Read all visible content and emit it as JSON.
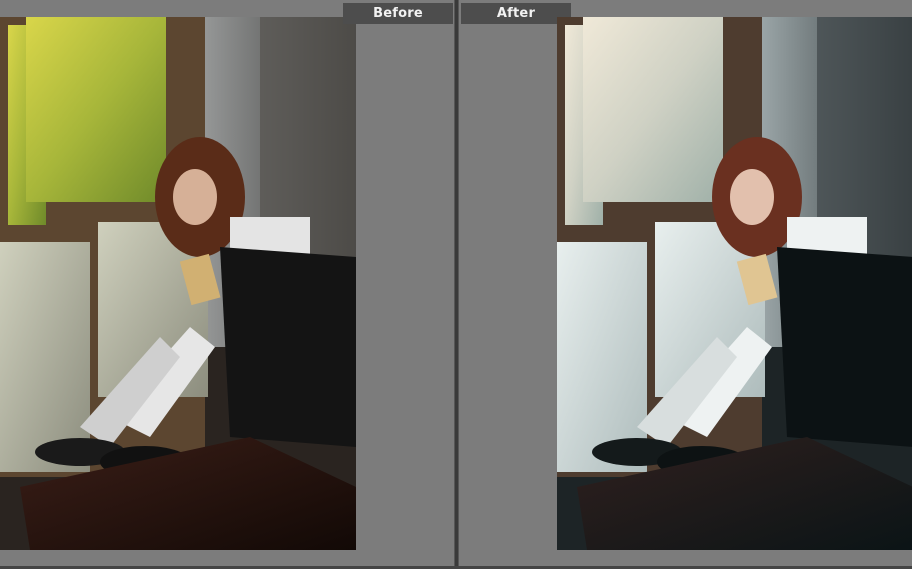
{
  "labels": {
    "before": "Before",
    "after": "After"
  },
  "colors": {
    "panel_bg": "#7c7c7c",
    "label_bg": "#4d4d4d",
    "label_text": "#f2f2f2",
    "divider": "#3a3a3a"
  }
}
